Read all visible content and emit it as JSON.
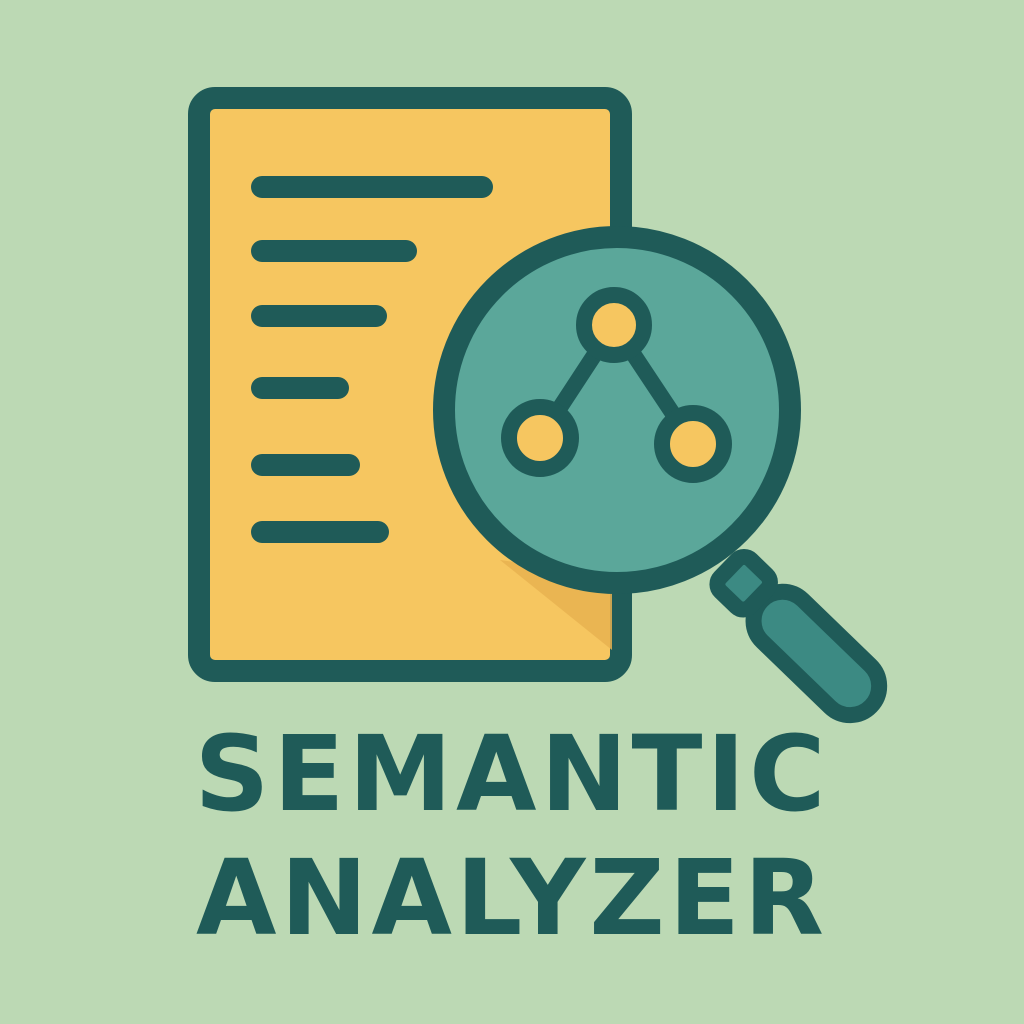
{
  "app": {
    "title_line_1": "SEMANTIC",
    "title_line_2": "ANALYZER"
  },
  "colors": {
    "background": "#bcd9b4",
    "document_fill": "#f6c660",
    "document_shadow": "#e7b150",
    "outline": "#1f5b58",
    "lens_fill": "#5ba79a",
    "handle_fill": "#3c8a83",
    "node_fill": "#f6c660",
    "title_text": "#1f5b58"
  },
  "icons": {
    "document": "document-icon",
    "magnifier": "magnifier-icon",
    "graph": "graph-network-icon"
  }
}
